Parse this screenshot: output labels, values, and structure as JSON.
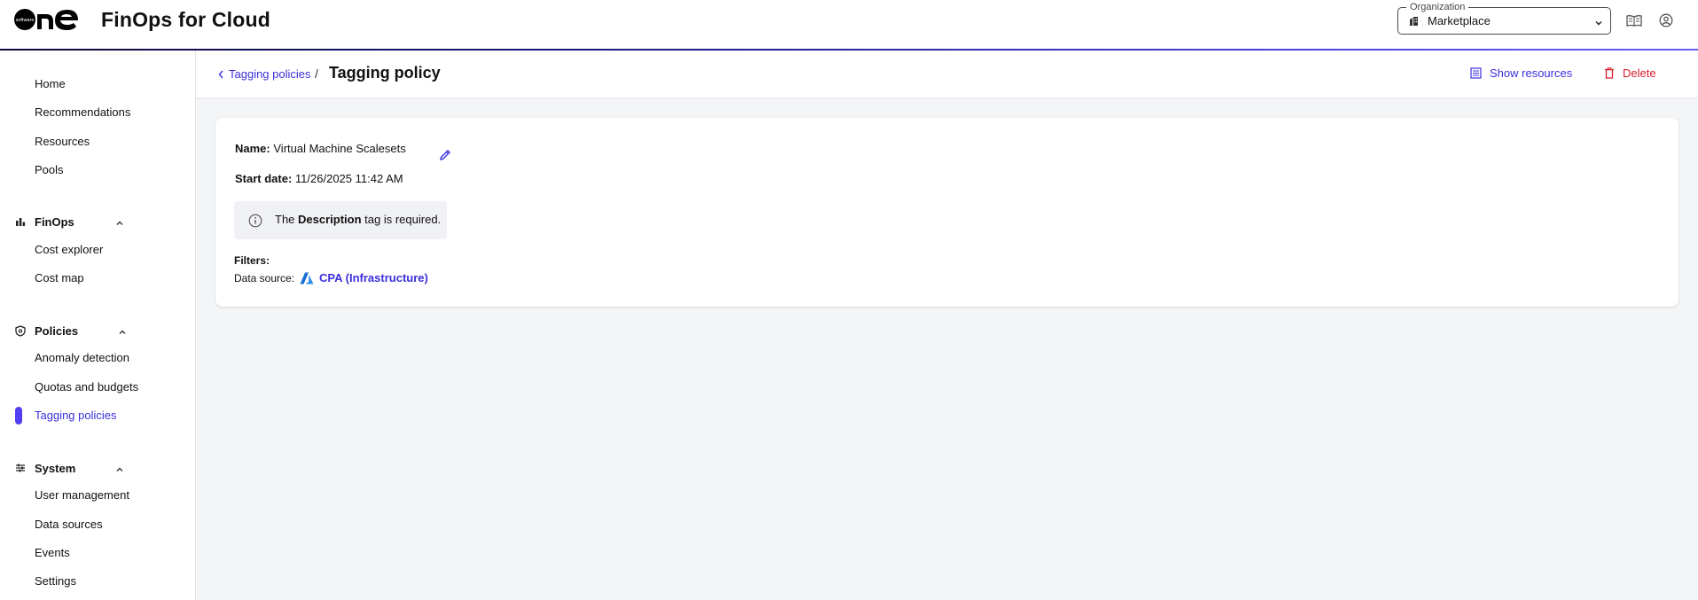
{
  "header": {
    "logo_text": "one",
    "logo_small": "software",
    "app_title": "FinOps for Cloud",
    "org_legend": "Organization",
    "org_value": "Marketplace"
  },
  "sidebar": {
    "top_items": [
      "Home",
      "Recommendations",
      "Resources",
      "Pools"
    ],
    "finops": {
      "label": "FinOps",
      "items": [
        "Cost explorer",
        "Cost map"
      ]
    },
    "policies": {
      "label": "Policies",
      "items": [
        "Anomaly detection",
        "Quotas and budgets",
        "Tagging policies"
      ]
    },
    "system": {
      "label": "System",
      "items": [
        "User management",
        "Data sources",
        "Events",
        "Settings"
      ]
    }
  },
  "breadcrumb": {
    "back_label": "Tagging policies",
    "separator": "/",
    "title": "Tagging policy"
  },
  "actions": {
    "show_resources": "Show resources",
    "delete": "Delete"
  },
  "policy": {
    "name_label": "Name:",
    "name_value": "Virtual Machine Scalesets",
    "start_label": "Start date:",
    "start_value": "11/26/2025 11:42 AM",
    "alert_pre": "The",
    "alert_bold": "Description",
    "alert_post": "tag is required.",
    "filters_label": "Filters:",
    "data_source_label": "Data source:",
    "data_source_value": "CPA (Infrastructure)"
  },
  "colors": {
    "accent": "#3b2fd9",
    "danger": "#d81b2b",
    "active_pill": "#5140f2"
  }
}
